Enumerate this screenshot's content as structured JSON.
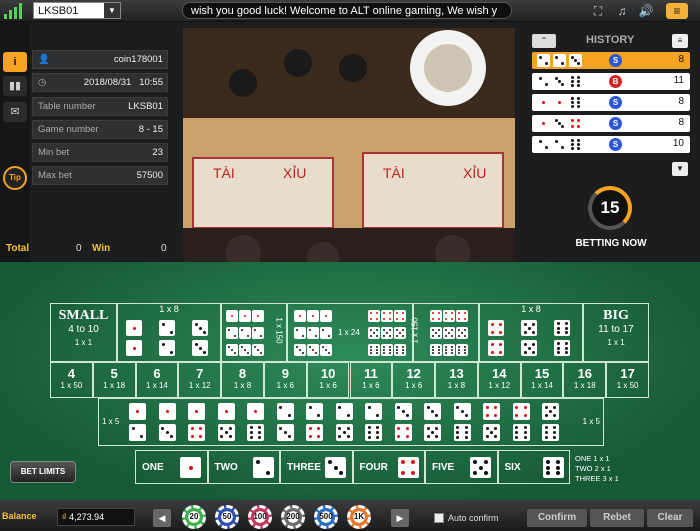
{
  "header": {
    "table_code": "LKSB01",
    "marquee": "wish you good luck!      Welcome to ALT online gaming, We wish y"
  },
  "info": {
    "username": "coin178001",
    "datetime": "2018/08/31   10:55",
    "rows": [
      {
        "label": "Table number",
        "value": "LKSB01"
      },
      {
        "label": "Game number",
        "value": "8 - 15"
      },
      {
        "label": "Min bet",
        "value": "23"
      },
      {
        "label": "Max bet",
        "value": "57500"
      }
    ],
    "total_label": "Total",
    "total_value": "0",
    "win_label": "Win",
    "win_value": "0"
  },
  "sidebar": {
    "info_icon": "i",
    "tip_label": "Tip"
  },
  "history": {
    "title": "HISTORY",
    "rows": [
      {
        "dice": [
          2,
          2,
          3
        ],
        "result": "S",
        "sum": "8",
        "selected": true
      },
      {
        "dice": [
          2,
          3,
          6
        ],
        "result": "B",
        "sum": "11"
      },
      {
        "dice": [
          1,
          1,
          6
        ],
        "result": "S",
        "sum": "8"
      },
      {
        "dice": [
          1,
          3,
          4
        ],
        "result": "S",
        "sum": "8"
      },
      {
        "dice": [
          2,
          2,
          6
        ],
        "result": "S",
        "sum": "10"
      }
    ],
    "colors": {
      "S": "#2b56d8",
      "B": "#d22424"
    }
  },
  "timer": {
    "value": "15",
    "status": "BETTING NOW"
  },
  "board": {
    "small": {
      "title": "SMALL",
      "range": "4 to 10",
      "payout": "1 x 1"
    },
    "big": {
      "title": "BIG",
      "range": "11 to 17",
      "payout": "1 x 1"
    },
    "double_payout": "1 x 8",
    "triple_payout": "1 x 150",
    "any_triple_payout": "1 x 24",
    "totals": [
      {
        "n": "4",
        "p": "1 x 50"
      },
      {
        "n": "5",
        "p": "1 x 18"
      },
      {
        "n": "6",
        "p": "1 x 14"
      },
      {
        "n": "7",
        "p": "1 x 12"
      },
      {
        "n": "8",
        "p": "1 x 8"
      },
      {
        "n": "9",
        "p": "1 x 6"
      },
      {
        "n": "10",
        "p": "1 x 6"
      },
      {
        "n": "11",
        "p": "1 x 6"
      },
      {
        "n": "12",
        "p": "1 x 6"
      },
      {
        "n": "13",
        "p": "1 x 8"
      },
      {
        "n": "14",
        "p": "1 x 12"
      },
      {
        "n": "15",
        "p": "1 x 14"
      },
      {
        "n": "16",
        "p": "1 x 18"
      },
      {
        "n": "17",
        "p": "1 x 50"
      }
    ],
    "combo_payout": "1 x 5",
    "singles": [
      {
        "label": "ONE",
        "face": 1
      },
      {
        "label": "TWO",
        "face": 2
      },
      {
        "label": "THREE",
        "face": 3
      },
      {
        "label": "FOUR",
        "face": 4
      },
      {
        "label": "FIVE",
        "face": 5
      },
      {
        "label": "SIX",
        "face": 6
      }
    ],
    "single_payouts": [
      "ONE 1 x 1",
      "TWO 2 x 1",
      "THREE 3 x 1"
    ],
    "bet_limits": "BET LIMITS"
  },
  "footer": {
    "balance_label": "Balance",
    "balance": "4,273.94",
    "chips": [
      "20",
      "50",
      "100",
      "200",
      "500",
      "1K"
    ],
    "auto_confirm": "Auto confirm",
    "confirm": "Confirm",
    "rebet": "Rebet",
    "clear": "Clear"
  }
}
